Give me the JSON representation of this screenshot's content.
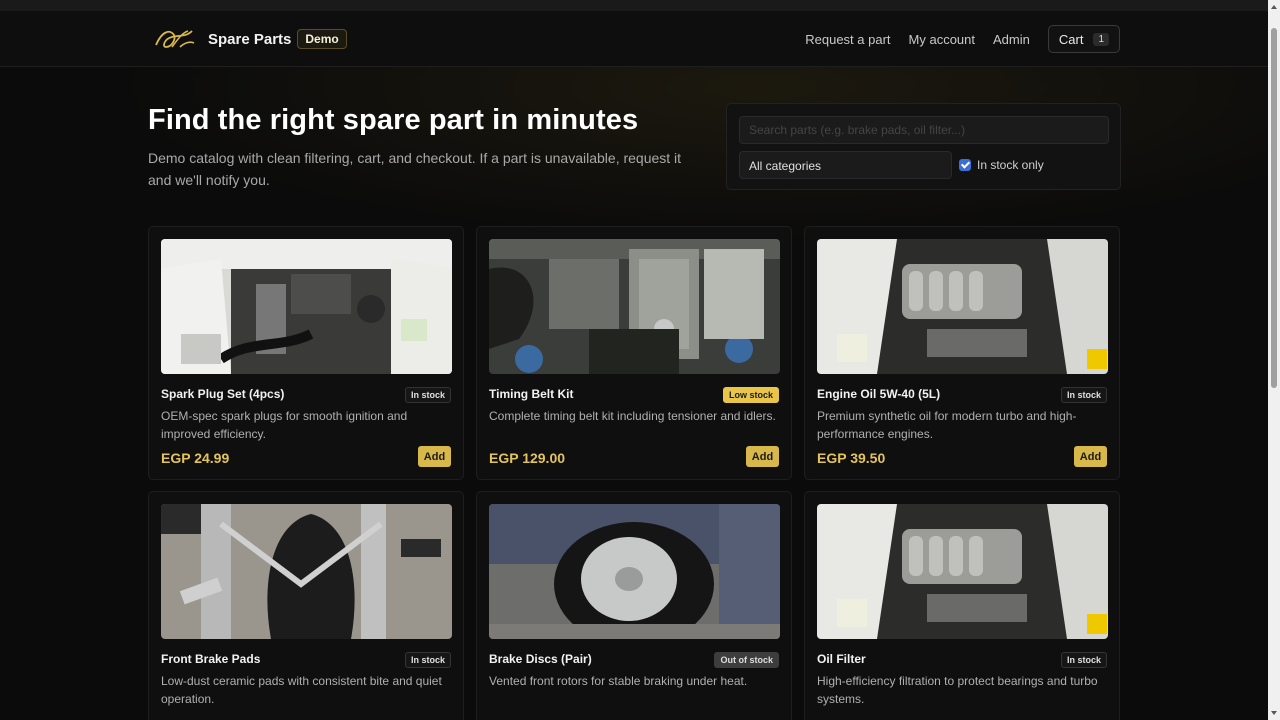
{
  "nav": {
    "brand": "Spare Parts",
    "badge": "Demo",
    "links": [
      "Request a part",
      "My account",
      "Admin"
    ],
    "cart_label": "Cart",
    "cart_count": "1"
  },
  "hero": {
    "title": "Find the right spare part in minutes",
    "subtitle": "Demo catalog with clean filtering, cart, and checkout. If a part is unavailable, request it and we'll notify you."
  },
  "filters": {
    "search_placeholder": "Search parts (e.g. brake pads, oil filter...)",
    "category": "All categories",
    "in_stock_label": "In stock only",
    "in_stock_checked": true
  },
  "products": [
    {
      "name": "Spark Plug Set (4pcs)",
      "status": "In stock",
      "status_type": "in",
      "description": "OEM-spec spark plugs for smooth ignition and improved efficiency.",
      "price": "EGP 24.99",
      "add_label": "Add",
      "image": "engine-bay-white"
    },
    {
      "name": "Timing Belt Kit",
      "status": "Low stock",
      "status_type": "low",
      "description": "Complete timing belt kit including tensioner and idlers.",
      "price": "EGP 129.00",
      "add_label": "Add",
      "image": "engine-dohc"
    },
    {
      "name": "Engine Oil 5W-40 (5L)",
      "status": "In stock",
      "status_type": "in",
      "description": "Premium synthetic oil for modern turbo and high-performance engines.",
      "price": "EGP 39.50",
      "add_label": "Add",
      "image": "engine-v6"
    },
    {
      "name": "Front Brake Pads",
      "status": "In stock",
      "status_type": "in",
      "description": "Low-dust ceramic pads with consistent bite and quiet operation.",
      "price": "",
      "add_label": "",
      "image": "bicycle-brake"
    },
    {
      "name": "Brake Discs (Pair)",
      "status": "Out of stock",
      "status_type": "out",
      "description": "Vented front rotors for stable braking under heat.",
      "price": "",
      "add_label": "",
      "image": "flat-tire"
    },
    {
      "name": "Oil Filter",
      "status": "In stock",
      "status_type": "in",
      "description": "High-efficiency filtration to protect bearings and turbo systems.",
      "price": "",
      "add_label": "",
      "image": "engine-v6"
    }
  ],
  "colors": {
    "accent": "#d8b84b",
    "price": "#e3c45c",
    "background": "#0b0b0b",
    "low_stock": "#e9c64a"
  }
}
